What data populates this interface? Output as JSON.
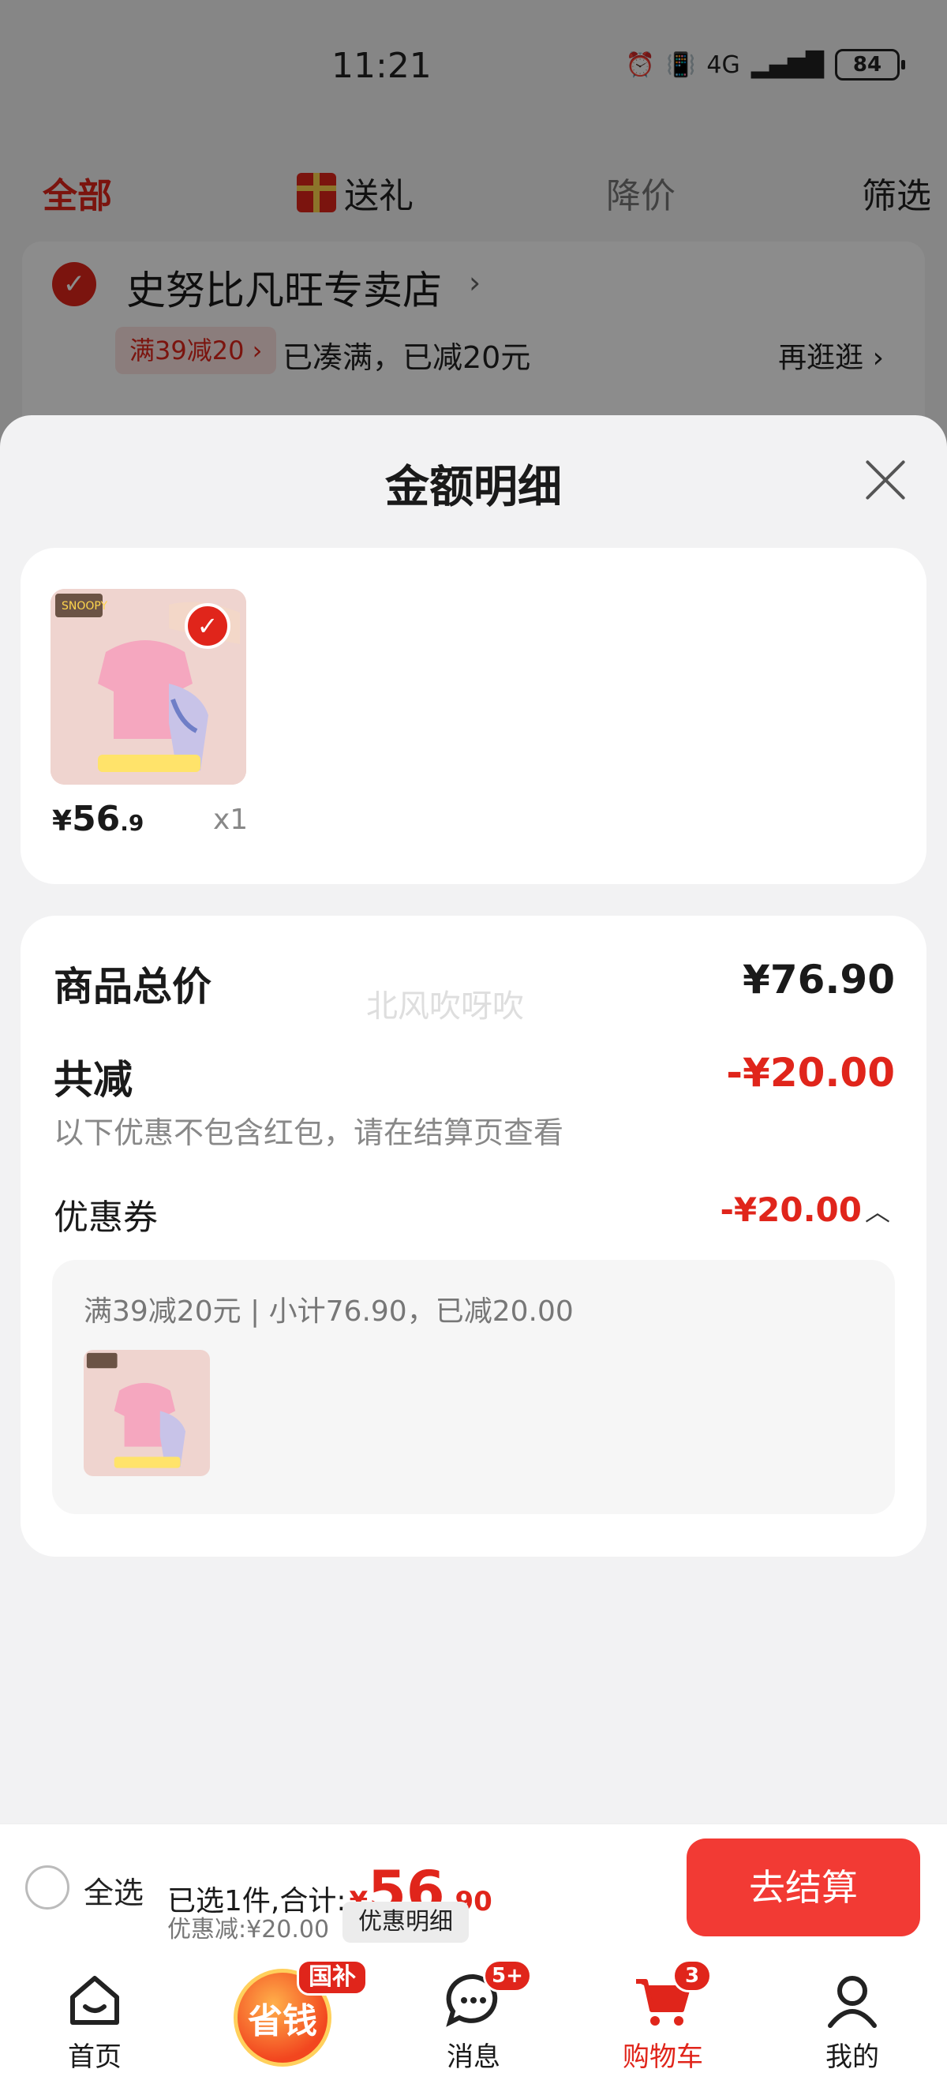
{
  "status_bar": {
    "time": "11:21",
    "network": "4G",
    "battery": "84"
  },
  "top_tabs": [
    {
      "label": "全部",
      "active": true
    },
    {
      "label": "送礼",
      "icon": "gift-icon"
    },
    {
      "label": "降价"
    },
    {
      "label": "筛选"
    }
  ],
  "store": {
    "name": "史努比凡旺专卖店",
    "chevron": "›",
    "promo_tag": "满39减20 ›",
    "promo_text": "已凑满，已减20元",
    "shop_more": "再逛逛 ›"
  },
  "sheet": {
    "title": "金额明细",
    "product": {
      "price_yen": "¥",
      "price_int": "56",
      "price_dec": ".9",
      "quantity": "x1",
      "image_tag": "SNOOPY"
    },
    "summary": {
      "total_label": "商品总价",
      "total_value": "¥76.90",
      "watermark": "北风吹呀吹",
      "reduce_label": "共减",
      "reduce_value": "-¥20.00",
      "note": "以下优惠不包含红包，请在结算页查看",
      "coupon_label": "优惠券",
      "coupon_value": "-¥20.00",
      "coupon_desc": "满39减20元 | 小计76.90，已减20.00"
    }
  },
  "checkout": {
    "select_all": "全选",
    "selected_text": "已选1件,合计:",
    "total_yen": "¥",
    "total_int": "56",
    "total_dec": ".90",
    "discount_text": "优惠减:¥20.00",
    "detail_button": "优惠明细",
    "pay_button": "去结算"
  },
  "bottom_nav": {
    "home": {
      "label": "首页"
    },
    "money": {
      "label": "省钱",
      "badge": "国补"
    },
    "messages": {
      "label": "消息",
      "badge": "5+"
    },
    "cart": {
      "label": "购物车",
      "badge": "3",
      "active": true
    },
    "mine": {
      "label": "我的"
    }
  },
  "colors": {
    "accent": "#e0251b",
    "pay_button": "#f23a34"
  }
}
